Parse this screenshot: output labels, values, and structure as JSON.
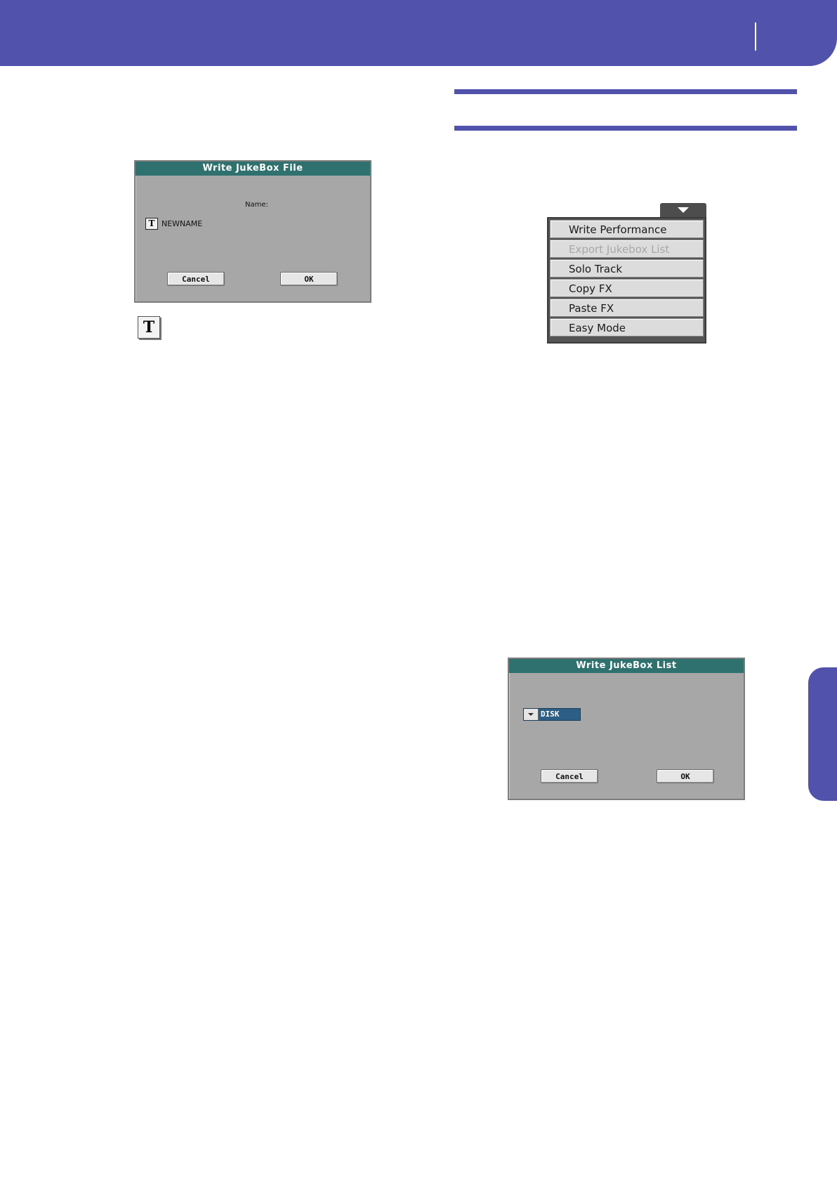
{
  "colors": {
    "brand": "#5052ab",
    "dialog_title_bar": "#2e716e",
    "dialog_body": "#a7a7a7",
    "selected_field": "#2d5f86"
  },
  "write_jukebox_file_dialog": {
    "title": "Write JukeBox File",
    "name_label": "Name:",
    "text_edit_icon": "T",
    "name_value": "NEWNAME",
    "cancel_label": "Cancel",
    "ok_label": "OK"
  },
  "text_edit_icon_large": "T",
  "page_menu": {
    "open_icon": "triangle-down-icon",
    "items": [
      {
        "label": "Write Performance",
        "enabled": true
      },
      {
        "label": "Export Jukebox List",
        "enabled": false
      },
      {
        "label": "Solo Track",
        "enabled": true
      },
      {
        "label": "Copy FX",
        "enabled": true
      },
      {
        "label": "Paste FX",
        "enabled": true
      },
      {
        "label": "Easy Mode",
        "enabled": true
      }
    ]
  },
  "write_jukebox_list_dialog": {
    "title": "Write JukeBox List",
    "device_value": "DISK",
    "cancel_label": "Cancel",
    "ok_label": "OK"
  }
}
